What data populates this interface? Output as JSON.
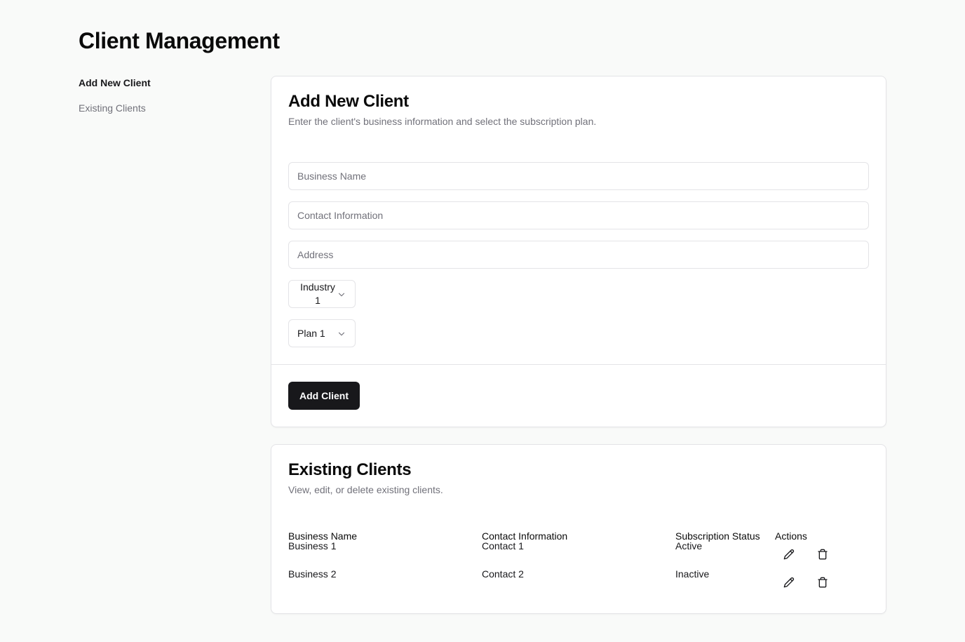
{
  "page": {
    "title": "Client Management"
  },
  "sidebar": {
    "items": [
      {
        "label": "Add New Client",
        "active": true
      },
      {
        "label": "Existing Clients",
        "active": false
      }
    ]
  },
  "add_client": {
    "title": "Add New Client",
    "description": "Enter the client's business information and select the subscription plan.",
    "fields": {
      "business_name": {
        "placeholder": "Business Name",
        "value": ""
      },
      "contact_information": {
        "placeholder": "Contact Information",
        "value": ""
      },
      "address": {
        "placeholder": "Address",
        "value": ""
      }
    },
    "industry_select": {
      "value": "Industry 1",
      "icon": "chevron-down-icon"
    },
    "plan_select": {
      "value": "Plan 1",
      "icon": "chevron-down-icon"
    },
    "submit_label": "Add Client"
  },
  "existing_clients": {
    "title": "Existing Clients",
    "description": "View, edit, or delete existing clients.",
    "columns": [
      "Business Name",
      "Contact Information",
      "Subscription Status",
      "Actions"
    ],
    "rows": [
      {
        "business_name": "Business 1",
        "contact": "Contact 1",
        "status": "Active"
      },
      {
        "business_name": "Business 2",
        "contact": "Contact 2",
        "status": "Inactive"
      }
    ],
    "action_icons": [
      "pencil-icon",
      "trash-icon"
    ]
  },
  "colors": {
    "background": "#f9faf9",
    "card": "#ffffff",
    "border": "#e4e4e7",
    "muted_text": "#71717a",
    "primary_button": "#18181b"
  }
}
